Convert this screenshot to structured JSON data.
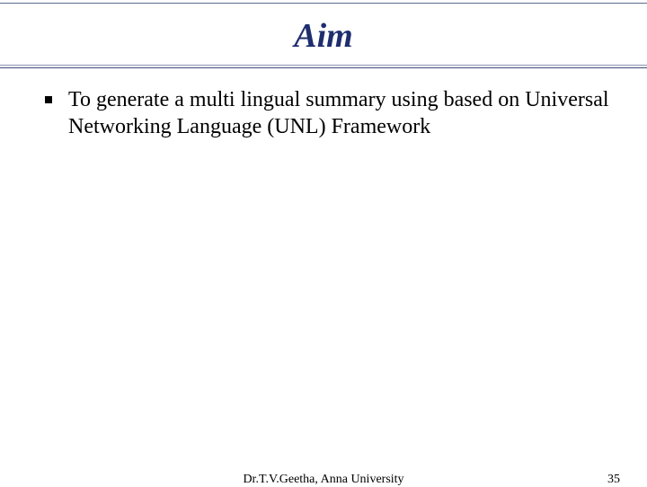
{
  "slide": {
    "title": "Aim",
    "bullets": [
      {
        "text": "To generate a multi lingual summary using based on Universal Networking Language (UNL) Framework"
      }
    ],
    "footer": {
      "center": "Dr.T.V.Geetha, Anna University",
      "page_number": "35"
    }
  }
}
